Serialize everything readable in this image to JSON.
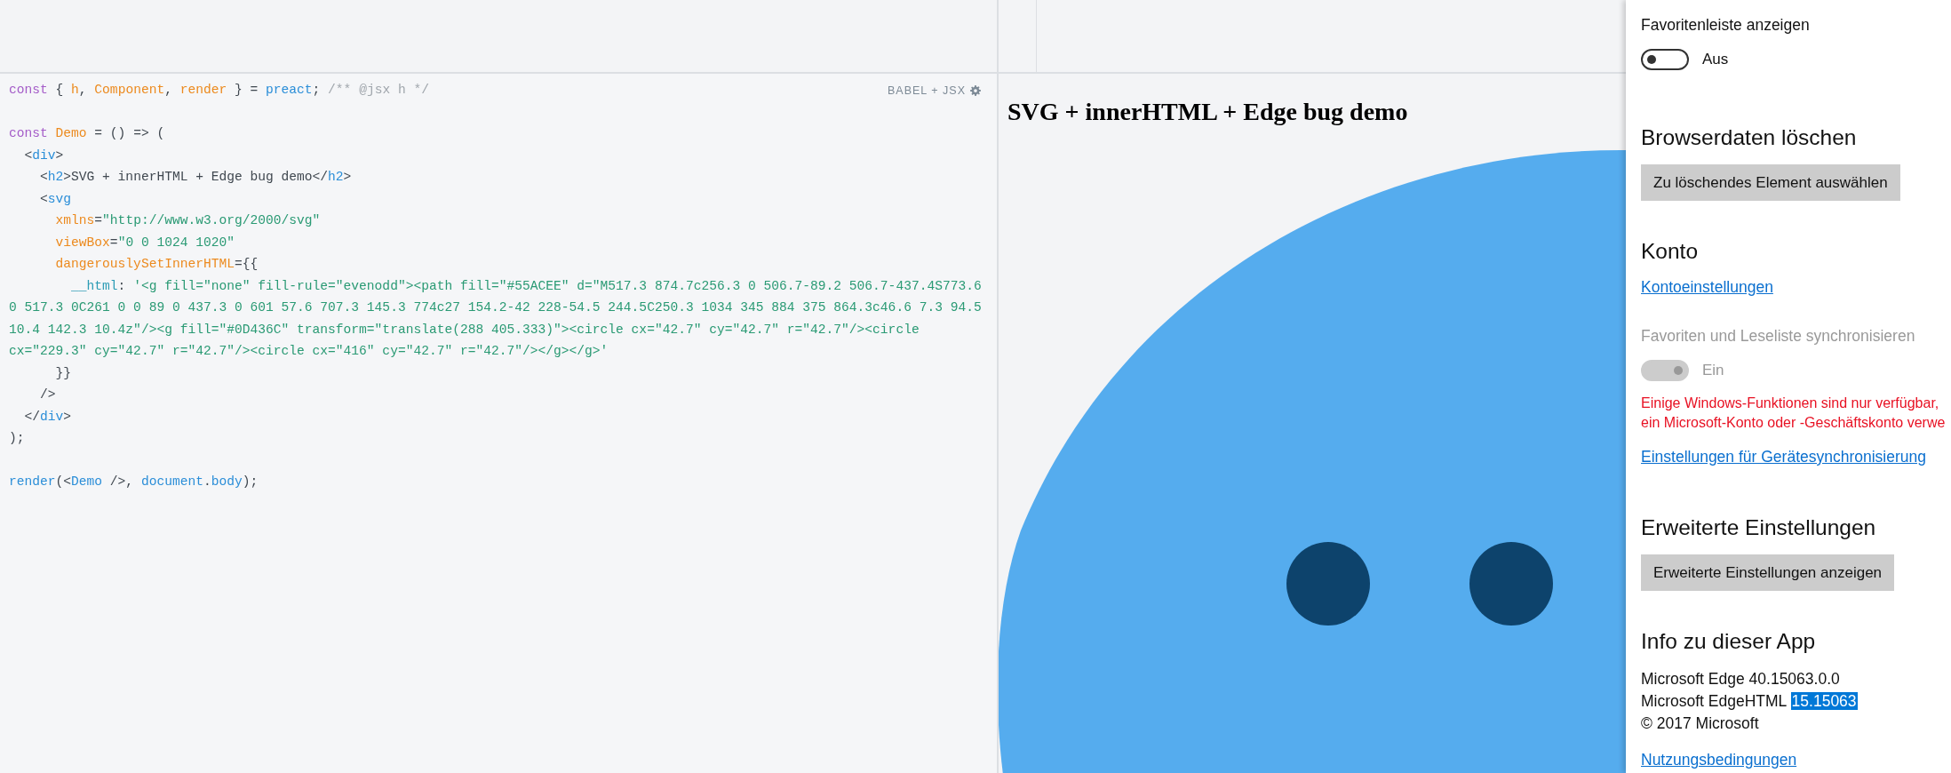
{
  "editor": {
    "language_label": "BABEL + JSX",
    "lines": [
      [
        {
          "kind": "keyword",
          "text": "const"
        },
        {
          "kind": "plain",
          "text": " { "
        },
        {
          "kind": "name",
          "text": "h"
        },
        {
          "kind": "plain",
          "text": ", "
        },
        {
          "kind": "name",
          "text": "Component"
        },
        {
          "kind": "plain",
          "text": ", "
        },
        {
          "kind": "name",
          "text": "render"
        },
        {
          "kind": "plain",
          "text": " } = "
        },
        {
          "kind": "builtin",
          "text": "preact"
        },
        {
          "kind": "plain",
          "text": "; "
        },
        {
          "kind": "comment",
          "text": "/** @jsx h */"
        }
      ],
      [
        {
          "kind": "blank"
        }
      ],
      [
        {
          "kind": "keyword",
          "text": "const"
        },
        {
          "kind": "name",
          "text": " Demo"
        },
        {
          "kind": "plain",
          "text": " = () => ("
        }
      ],
      [
        {
          "kind": "plain",
          "text": "  <"
        },
        {
          "kind": "builtin",
          "text": "div"
        },
        {
          "kind": "plain",
          "text": ">"
        }
      ],
      [
        {
          "kind": "plain",
          "text": "    <"
        },
        {
          "kind": "builtin",
          "text": "h2"
        },
        {
          "kind": "plain",
          "text": ">SVG + innerHTML + Edge bug demo</"
        },
        {
          "kind": "builtin",
          "text": "h2"
        },
        {
          "kind": "plain",
          "text": ">"
        }
      ],
      [
        {
          "kind": "plain",
          "text": "    <"
        },
        {
          "kind": "builtin",
          "text": "svg"
        }
      ],
      [
        {
          "kind": "name",
          "text": "      xmlns"
        },
        {
          "kind": "plain",
          "text": "="
        },
        {
          "kind": "string",
          "text": "\"http://www.w3.org/2000/svg\""
        }
      ],
      [
        {
          "kind": "name",
          "text": "      viewBox"
        },
        {
          "kind": "plain",
          "text": "="
        },
        {
          "kind": "string",
          "text": "\"0 0 1024 1020\""
        }
      ],
      [
        {
          "kind": "name",
          "text": "      dangerouslySetInnerHTML"
        },
        {
          "kind": "plain",
          "text": "={{"
        }
      ],
      [
        {
          "kind": "property",
          "text": "        __html"
        },
        {
          "kind": "plain",
          "text": ": "
        },
        {
          "kind": "string",
          "text": "'<g fill=\"none\" fill-rule=\"evenodd\"><path fill=\"#55ACEE\" d=\"M517.3 874.7c256.3 0 506.7-89.2 506.7-437.4S773.6"
        }
      ],
      [
        {
          "kind": "string",
          "text": "0 517.3 0C261 0 0 89 0 437.3 0 601 57.6 707.3 145.3 774c27 154.2-42 228-54.5 244.5C250.3 1034 345 884 375 864.3c46.6 7.3 94.5"
        }
      ],
      [
        {
          "kind": "string",
          "text": "10.4 142.3 10.4z\"/><g fill=\"#0D436C\" transform=\"translate(288 405.333)\"><circle cx=\"42.7\" cy=\"42.7\" r=\"42.7\"/><circle"
        }
      ],
      [
        {
          "kind": "string",
          "text": "cx=\"229.3\" cy=\"42.7\" r=\"42.7\"/><circle cx=\"416\" cy=\"42.7\" r=\"42.7\"/></g></g>'"
        }
      ],
      [
        {
          "kind": "plain",
          "text": "      }}"
        }
      ],
      [
        {
          "kind": "plain",
          "text": "    />"
        }
      ],
      [
        {
          "kind": "plain",
          "text": "  </"
        },
        {
          "kind": "builtin",
          "text": "div"
        },
        {
          "kind": "plain",
          "text": ">"
        }
      ],
      [
        {
          "kind": "plain",
          "text": ");"
        }
      ],
      [
        {
          "kind": "blank"
        }
      ],
      [
        {
          "kind": "builtin",
          "text": "render"
        },
        {
          "kind": "plain",
          "text": "(<"
        },
        {
          "kind": "builtin",
          "text": "Demo"
        },
        {
          "kind": "plain",
          "text": " />, "
        },
        {
          "kind": "builtin",
          "text": "document"
        },
        {
          "kind": "plain",
          "text": "."
        },
        {
          "kind": "builtin",
          "text": "body"
        },
        {
          "kind": "plain",
          "text": ");"
        }
      ]
    ]
  },
  "preview": {
    "heading": "SVG + innerHTML + Edge bug demo"
  },
  "settings": {
    "items": [
      {
        "kind": "label",
        "text": "Favoritenleiste anzeigen",
        "disabled": false
      },
      {
        "kind": "toggle",
        "label": "Aus",
        "on": false,
        "disabled": false
      },
      {
        "kind": "heading",
        "text": "Browserdaten löschen"
      },
      {
        "kind": "button",
        "text": "Zu löschendes Element auswählen"
      },
      {
        "kind": "heading",
        "text": "Konto"
      },
      {
        "kind": "link",
        "text": "Kontoeinstellungen"
      },
      {
        "kind": "label",
        "text": "Favoriten und Leseliste synchronisieren",
        "disabled": true
      },
      {
        "kind": "toggle",
        "label": "Ein",
        "on": true,
        "disabled": true
      },
      {
        "kind": "warning",
        "lines": [
          "Einige Windows-Funktionen sind nur verfügbar,",
          "ein Microsoft-Konto oder -Geschäftskonto verwe"
        ]
      },
      {
        "kind": "link",
        "text": "Einstellungen für Gerätesynchronisierung"
      },
      {
        "kind": "heading",
        "text": "Erweiterte Einstellungen"
      },
      {
        "kind": "button",
        "text": "Erweiterte Einstellungen anzeigen"
      },
      {
        "kind": "heading",
        "text": "Info zu dieser App"
      },
      {
        "kind": "info",
        "lines": [
          {
            "text": "Microsoft Edge 40.15063.0.0"
          },
          {
            "text": "Microsoft EdgeHTML",
            "highlight": "15.15063",
            "selected": true
          },
          {
            "text": "© 2017 Microsoft"
          }
        ]
      },
      {
        "kind": "link",
        "text": "Nutzungsbedingungen"
      }
    ]
  }
}
